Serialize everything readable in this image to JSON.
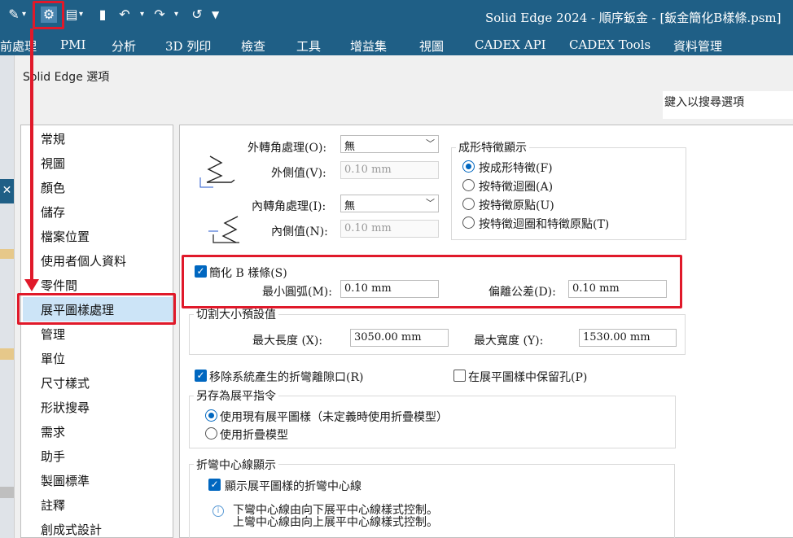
{
  "window": {
    "title": "Solid Edge 2024 - 順序鈑金 - [鈑金簡化B樣條.psm]"
  },
  "ribbon": {
    "tabs": [
      "前處理",
      "PMI",
      "分析",
      "3D 列印",
      "檢查",
      "工具",
      "增益集",
      "視圖",
      "CADEX API",
      "CADEX Tools",
      "資料管理"
    ],
    "active_tab": "視圖"
  },
  "dialog": {
    "title": "Solid Edge 選項",
    "search_placeholder": "鍵入以搜尋選項"
  },
  "nav": {
    "items": [
      "常規",
      "視圖",
      "顏色",
      "儲存",
      "檔案位置",
      "使用者個人資料",
      "零件間",
      "展平圖樣處理",
      "管理",
      "單位",
      "尺寸樣式",
      "形狀搜尋",
      "需求",
      "助手",
      "製圖標準",
      "註釋",
      "創成式設計"
    ],
    "selected": "展平圖樣處理"
  },
  "corner": {
    "outer_label": "外轉角處理(O):",
    "outer_value": "無",
    "outer_side_label": "外側值(V):",
    "outer_side_value": "0.10 mm",
    "inner_label": "內轉角處理(I):",
    "inner_value": "無",
    "inner_side_label": "內側值(N):",
    "inner_side_value": "0.10 mm"
  },
  "feature_display": {
    "title": "成形特徵顯示",
    "options": [
      "按成形特徵(F)",
      "按特徵迴圈(A)",
      "按特徵原點(U)",
      "按特徵迴圈和特徵原點(T)"
    ],
    "selected": "按成形特徵(F)"
  },
  "bspline": {
    "checkbox_label": "簡化 B 樣條(S)",
    "checked": true,
    "min_arc_label": "最小圓弧(M):",
    "min_arc_value": "0.10 mm",
    "offset_tol_label": "偏離公差(D):",
    "offset_tol_value": "0.10 mm"
  },
  "cut_size": {
    "title": "切割大小預設值",
    "max_length_label": "最大長度 (X):",
    "max_length_value": "3050.00 mm",
    "max_width_label": "最大寬度 (Y):",
    "max_width_value": "1530.00 mm"
  },
  "relief": {
    "remove_label": "移除系統產生的折彎離隙口(R)",
    "remove_checked": true,
    "keep_holes_label": "在展平圖樣中保留孔(P)",
    "keep_holes_checked": false
  },
  "save_as_flat": {
    "title": "另存為展平指令",
    "options": [
      "使用現有展平圖樣（未定義時使用折疊模型）",
      "使用折疊模型"
    ],
    "selected": "使用現有展平圖樣（未定義時使用折疊模型）"
  },
  "bend_centerline": {
    "title": "折彎中心線顯示",
    "show_label": "顯示展平圖樣的折彎中心線",
    "show_checked": true,
    "info_line1": "下彎中心線由向下展平中心線樣式控制。",
    "info_line2": "上彎中心線由向上展平中心線樣式控制。"
  },
  "colors": {
    "title_bar": "#1f5f86",
    "highlight_red": "#e0192a",
    "accent_blue": "#0067c0",
    "nav_selected": "#cce4f7"
  }
}
